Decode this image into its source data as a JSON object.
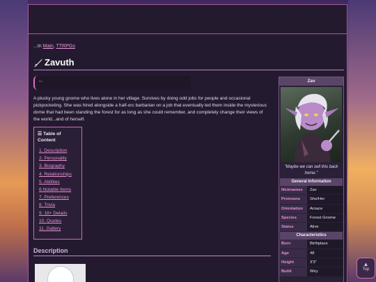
{
  "breadcrumb": {
    "prefix": "...In",
    "links": [
      "Main",
      "TTRPGs"
    ]
  },
  "page_title": "Zavuth",
  "quote_box": {
    "text": "--"
  },
  "intro": "A plucky young gnome who lives alone in her village. Survives by doing odd jobs for people and occasional pickpocketing. She was hired alongside a half-orc barbarian on a job that eventually led them inside the mysterious dome that had been standing the forest for as long as she could remember, and completely change their views of the world...and of herself.",
  "toc": {
    "title": "Table of Content",
    "items": [
      "1. Description",
      "2. Personality",
      "3. Biography",
      "4. Relationships",
      "5. Abilities",
      "6.Notable Items",
      "7. Preferences",
      "8. Trivia",
      "9. 18+ Details",
      "10. Quotes",
      "11. Gallery"
    ]
  },
  "section": {
    "title": "Description"
  },
  "infobox": {
    "name": "Zav",
    "caption": "\"Maybe we can sell this back home.\"",
    "general_title": "General Information",
    "general": [
      {
        "key": "Nicknames",
        "value": "Zav"
      },
      {
        "key": "Pronouns",
        "value": "She/Her"
      },
      {
        "key": "Orientation",
        "value": "Aroace"
      },
      {
        "key": "Species",
        "value": "Forest Gnome"
      },
      {
        "key": "Status",
        "value": "Alive"
      }
    ],
    "characteristics_title": "Characteristics",
    "characteristics": [
      {
        "key": "Born",
        "value": "Birthplace"
      },
      {
        "key": "Age",
        "value": "48"
      },
      {
        "key": "Height",
        "value": "3'3\""
      },
      {
        "key": "Build",
        "value": "Wiry"
      }
    ]
  },
  "top_button": {
    "label": "Top"
  },
  "colors": {
    "accent": "#e98fd8",
    "border": "#a35aa3",
    "panel": "#241a2f"
  }
}
